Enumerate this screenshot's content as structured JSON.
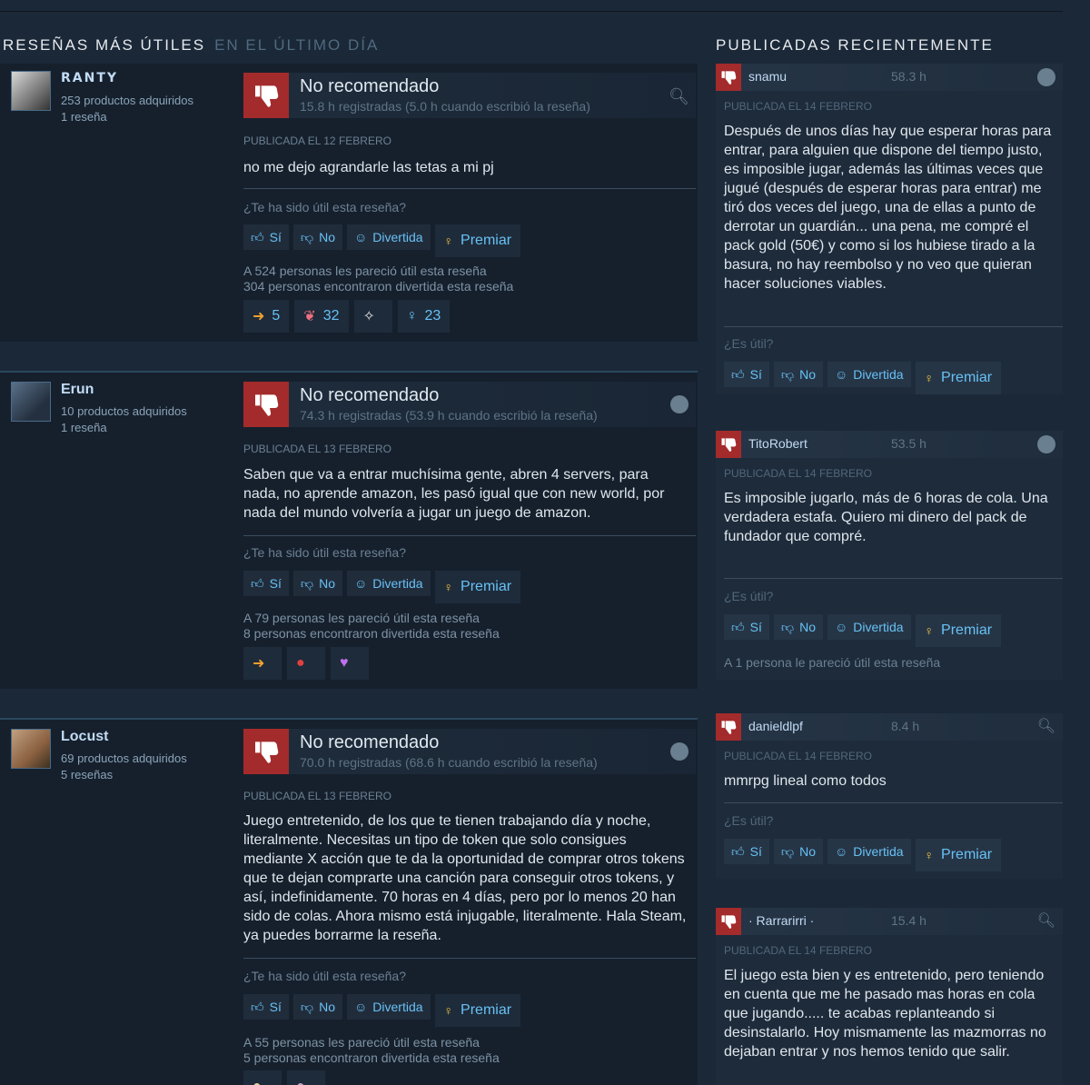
{
  "sections": {
    "left_title": "RESEÑAS MÁS ÚTILES",
    "left_subtitle": "EN EL ÚLTIMO DÍA",
    "right_title": "PUBLICADAS RECIENTEMENTE"
  },
  "buttons": {
    "yes": "Sí",
    "no": "No",
    "funny": "Divertida",
    "award": "Premiar"
  },
  "helpful_question": "¿Te ha sido útil esta reseña?",
  "helpful_question_short": "¿Es útil?",
  "colors": {
    "background": "#1b2838",
    "thumb_down": "#a32b2b",
    "link": "#67c1f5",
    "award_gold": "#f5c842"
  },
  "reviews": [
    {
      "author": "RANTY",
      "products": "253 productos adquiridos",
      "reviews_count": "1 reseña",
      "verdict": "No recomendado",
      "hours": "15.8 h registradas (5.0 h cuando escribió la reseña)",
      "posted": "PUBLICADA EL 12 FEBRERO",
      "text": "no me dejo agrandarle las tetas a mi pj",
      "helpful": "A 524 personas les pareció útil esta reseña",
      "funny": "304 personas encontraron divertida esta reseña",
      "awards": [
        "5",
        "32",
        "",
        "23"
      ]
    },
    {
      "author": "Erun",
      "products": "10 productos adquiridos",
      "reviews_count": "1 reseña",
      "verdict": "No recomendado",
      "hours": "74.3 h registradas (53.9 h cuando escribió la reseña)",
      "posted": "PUBLICADA EL 13 FEBRERO",
      "text": "Saben que va a entrar muchísima gente, abren 4 servers, para nada, no aprende amazon, les pasó igual que con new world, por nada del mundo volvería a jugar un juego de amazon.",
      "helpful": "A 79 personas les pareció útil esta reseña",
      "funny": "8 personas encontraron divertida esta reseña"
    },
    {
      "author": "Locust",
      "products": "69 productos adquiridos",
      "reviews_count": "5 reseñas",
      "verdict": "No recomendado",
      "hours": "70.0 h registradas (68.6 h cuando escribió la reseña)",
      "posted": "PUBLICADA EL 13 FEBRERO",
      "text": "Juego entretenido, de los que te tienen trabajando día y noche, literalmente. Necesitas un tipo de token que solo consigues mediante X acción que te da la oportunidad de comprar otros tokens que te dejan comprarte una canción para conseguir otros tokens, y así, indefinidamente. 70 horas en 4 días, pero por lo menos 20 han sido de colas. Ahora mismo está injugable, literalmente. Hala Steam, ya puedes borrarme la reseña.",
      "helpful": "A 55 personas les pareció útil esta reseña",
      "funny": "5 personas encontraron divertida esta reseña"
    }
  ],
  "recent": [
    {
      "author": "snamu",
      "hours": "58.3 h",
      "posted": "PUBLICADA EL 14 FEBRERO",
      "text": "Después de unos días hay que esperar horas para entrar, para alguien que dispone del tiempo justo, es imposible jugar, además las últimas veces que jugué (después de esperar horas para entrar) me tiró dos veces del juego, una de ellas a punto de derrotar un guardián... una pena, me compré el pack gold (50€) y como si los hubiese tirado a la basura, no hay reembolso y no veo que quieran hacer soluciones viables."
    },
    {
      "author": "TitoRobert",
      "hours": "53.5 h",
      "posted": "PUBLICADA EL 14 FEBRERO",
      "text": "Es imposible jugarlo, más de 6 horas de cola. Una verdadera estafa. Quiero mi dinero del pack de fundador que compré.",
      "helpful": "A 1 persona le pareció útil esta reseña"
    },
    {
      "author": "danieldlpf",
      "hours": "8.4 h",
      "posted": "PUBLICADA EL 14 FEBRERO",
      "text": "mmrpg lineal como todos"
    },
    {
      "author": "· Rarrarirri ·",
      "hours": "15.4 h",
      "posted": "PUBLICADA EL 14 FEBRERO",
      "text": "El juego esta bien y es entretenido, pero teniendo en cuenta que me he pasado mas horas en cola que jugando..... te acabas replanteando si desinstalarlo. Hoy mismamente las mazmorras no dejaban entrar y nos hemos tenido que salir."
    }
  ]
}
